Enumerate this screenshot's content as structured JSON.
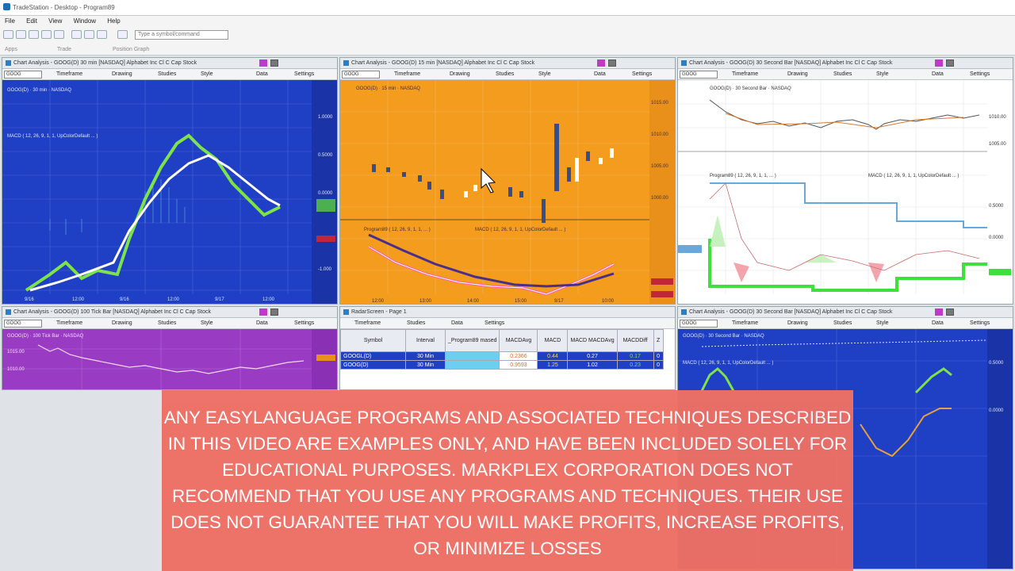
{
  "window": {
    "title": "TradeStation - Desktop - Program89"
  },
  "menu": [
    "File",
    "Edit",
    "View",
    "Window",
    "Help"
  ],
  "toolbar": {
    "symbol_placeholder": "Type a symbol/command",
    "groups": [
      "Apps",
      "Trade",
      "Position Graph"
    ]
  },
  "panes": {
    "p1": {
      "title": "Chart Analysis - GOOG(D) 30 min [NASDAQ] Alphabet Inc Cl C Cap Stock",
      "symbol": "GOOG",
      "tools": [
        "Timeframe",
        "Drawing",
        "Studies",
        "Style",
        "Data",
        "Settings"
      ],
      "bg": "#1f3fc4"
    },
    "p2": {
      "title": "Chart Analysis - GOOG(D) 15 min [NASDAQ] Alphabet Inc Cl C Cap Stock",
      "symbol": "GOOG",
      "tools": [
        "Timeframe",
        "Drawing",
        "Studies",
        "Style",
        "Data",
        "Settings"
      ],
      "bg": "#f39c1e"
    },
    "p3": {
      "title": "Chart Analysis - GOOG(D) 30 Second Bar [NASDAQ] Alphabet Inc Cl C Cap Stock",
      "symbol": "GOOG",
      "tools": [
        "Timeframe",
        "Drawing",
        "Studies",
        "Style",
        "Data",
        "Settings"
      ],
      "bg": "#ffffff"
    },
    "p4": {
      "title": "Chart Analysis - GOOG(D) 100 Tick Bar [NASDAQ] Alphabet Inc Cl C Cap Stock",
      "symbol": "GOOG",
      "tools": [
        "Timeframe",
        "Drawing",
        "Studies",
        "Style",
        "Data",
        "Settings"
      ],
      "bg": "#9a3bc4"
    },
    "p5": {
      "title": "RadarScreen - Page 1",
      "tools": [
        "Timeframe",
        "Studies",
        "Data",
        "Settings"
      ]
    },
    "p6": {
      "title": "Chart Analysis - GOOG(D) 30 Second Bar [NASDAQ] Alphabet Inc Cl C Cap Stock",
      "symbol": "GOOG",
      "tools": [
        "Timeframe",
        "Drawing",
        "Studies",
        "Style",
        "Data",
        "Settings"
      ],
      "bg": "#1f3fc4"
    }
  },
  "radar": {
    "headers": [
      "Symbol",
      "Interval",
      "_Program89 mased",
      "MACDAvg",
      "MACD",
      "MACD MACDAvg",
      "MACDDiff",
      "Z"
    ],
    "rows": [
      {
        "symbol": "GOOGL(D)",
        "interval": "30 Min",
        "macdavg": "0.2366",
        "macd": "0.44",
        "macd2": "0.27",
        "diff": "0.17",
        "z": "0"
      },
      {
        "symbol": "GOOG(D)",
        "interval": "30 Min",
        "macdavg": "0.9593",
        "macd": "1.25",
        "macd2": "1.02",
        "diff": "0.23",
        "z": "0"
      }
    ]
  },
  "disclaimer": "ANY EASYLANGUAGE PROGRAMS AND ASSOCIATED TECHNIQUES DESCRIBED IN THIS VIDEO ARE EXAMPLES ONLY, AND HAVE BEEN INCLUDED SOLELY FOR EDUCATIONAL PURPOSES. MARKPLEX CORPORATION DOES NOT RECOMMEND THAT YOU USE ANY PROGRAMS AND TECHNIQUES. THEIR USE DOES NOT GUARANTEE THAT YOU WILL MAKE PROFITS, INCREASE PROFITS, OR MINIMIZE LOSSES"
}
